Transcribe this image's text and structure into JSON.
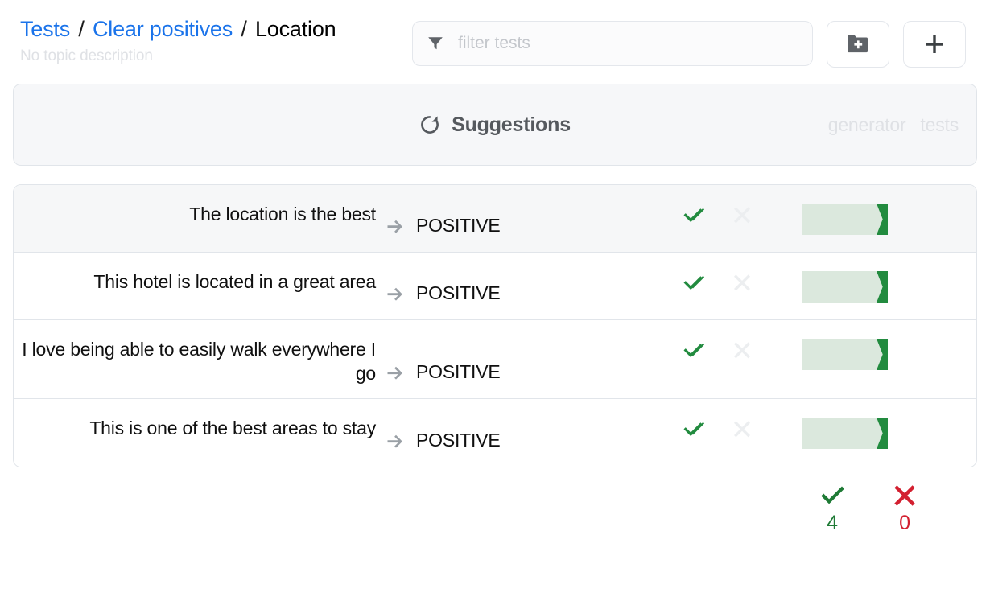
{
  "header": {
    "breadcrumb": {
      "items": [
        {
          "label": "Tests",
          "link": true
        },
        {
          "label": "Clear positives",
          "link": true
        },
        {
          "label": "Location",
          "link": false
        }
      ],
      "separator": "/"
    },
    "topic_description": "No topic description",
    "filter": {
      "icon": "filter-funnel-icon",
      "value": "",
      "placeholder": "filter tests"
    },
    "buttons": [
      {
        "name": "new-topic-button",
        "icon": "folder-plus-icon"
      },
      {
        "name": "new-test-button",
        "icon": "plus-icon"
      }
    ]
  },
  "suggestions": {
    "icon": "refresh-icon",
    "title": "Suggestions",
    "columns": [
      {
        "label": "generator"
      },
      {
        "label": "tests"
      }
    ]
  },
  "tests": {
    "rows": [
      {
        "text": "The location is the best",
        "arrow": "arrow-right-icon",
        "label": "POSITIVE",
        "accept_icon": "check-double-icon",
        "reject_icon": "x-icon",
        "score_percent": 100,
        "highlighted": true
      },
      {
        "text": "This hotel is located in a great area",
        "arrow": "arrow-right-icon",
        "label": "POSITIVE",
        "accept_icon": "check-double-icon",
        "reject_icon": "x-icon",
        "score_percent": 100,
        "highlighted": false
      },
      {
        "text": "I love being able to easily walk everywhere I go",
        "arrow": "arrow-right-icon",
        "label": "POSITIVE",
        "accept_icon": "check-double-icon",
        "reject_icon": "x-icon",
        "score_percent": 100,
        "highlighted": false
      },
      {
        "text": "This is one of the best areas to stay",
        "arrow": "arrow-right-icon",
        "label": "POSITIVE",
        "accept_icon": "check-double-icon",
        "reject_icon": "x-icon",
        "score_percent": 100,
        "highlighted": false
      }
    ]
  },
  "footer": {
    "pass": {
      "icon": "check-icon",
      "count": "4"
    },
    "fail": {
      "icon": "cross-icon",
      "count": "0"
    }
  },
  "colors": {
    "link": "#1a73ea",
    "pass_green": "#1e7a35",
    "marker_green": "#228b3f",
    "bar_green": "#dbe8dd",
    "fail_red": "#d32030",
    "muted": "#dfe1e5",
    "border": "#e1e5ea"
  }
}
